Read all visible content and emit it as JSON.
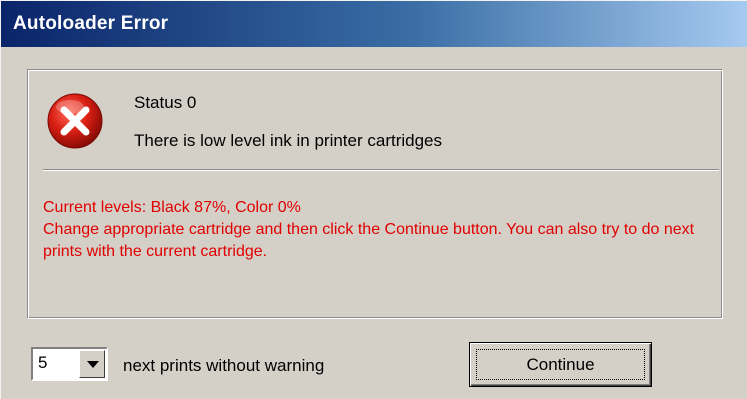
{
  "window": {
    "title": "Autoloader Error"
  },
  "dialog": {
    "icon": "error-icon",
    "status": "Status 0",
    "message": "There is low level ink in printer cartridges",
    "levels": "Current levels: Black 87%, Color 0%",
    "instructions": "Change appropriate cartridge and then click the Continue button. You can also try to do next prints with the current cartridge."
  },
  "footer": {
    "count_value": "5",
    "count_label": "next prints without warning",
    "continue_label": "Continue"
  },
  "colors": {
    "title_start": "#0a246a",
    "title_end": "#a6caf0",
    "warning_text": "#e00000",
    "face": "#d4d0c8"
  }
}
